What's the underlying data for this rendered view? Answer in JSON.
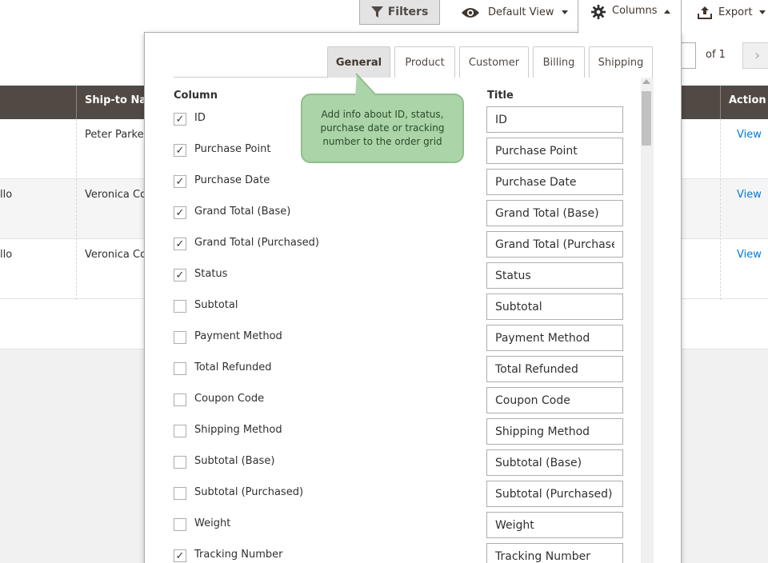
{
  "toolbar": {
    "filters_label": "Filters",
    "view_label": "Default View",
    "columns_label": "Columns",
    "export_label": "Export"
  },
  "pager": {
    "of_text": "of 1"
  },
  "grid": {
    "headers": {
      "ship_to": "Ship-to Nam",
      "action": "Action"
    },
    "rows": [
      {
        "left": "",
        "ship_to": "Peter Parker",
        "action": "View"
      },
      {
        "left": "llo",
        "ship_to": "Veronica Cos",
        "action": "View"
      },
      {
        "left": "llo",
        "ship_to": "Veronica Cos",
        "action": "View"
      }
    ]
  },
  "columns_panel": {
    "tabs": [
      {
        "label": "General",
        "active": true
      },
      {
        "label": "Product",
        "active": false
      },
      {
        "label": "Customer",
        "active": false
      },
      {
        "label": "Billing",
        "active": false
      },
      {
        "label": "Shipping",
        "active": false
      }
    ],
    "column_header": "Column",
    "title_header": "Title",
    "items": [
      {
        "label": "ID",
        "checked": true,
        "title": "ID"
      },
      {
        "label": "Purchase Point",
        "checked": true,
        "title": "Purchase Point"
      },
      {
        "label": "Purchase Date",
        "checked": true,
        "title": "Purchase Date"
      },
      {
        "label": "Grand Total (Base)",
        "checked": true,
        "title": "Grand Total (Base)"
      },
      {
        "label": "Grand Total (Purchased)",
        "checked": true,
        "title": "Grand Total (Purchased)"
      },
      {
        "label": "Status",
        "checked": true,
        "title": "Status"
      },
      {
        "label": "Subtotal",
        "checked": false,
        "title": "Subtotal"
      },
      {
        "label": "Payment Method",
        "checked": false,
        "title": "Payment Method"
      },
      {
        "label": "Total Refunded",
        "checked": false,
        "title": "Total Refunded"
      },
      {
        "label": "Coupon Code",
        "checked": false,
        "title": "Coupon Code"
      },
      {
        "label": "Shipping Method",
        "checked": false,
        "title": "Shipping Method"
      },
      {
        "label": "Subtotal (Base)",
        "checked": false,
        "title": "Subtotal (Base)"
      },
      {
        "label": "Subtotal (Purchased)",
        "checked": false,
        "title": "Subtotal (Purchased)"
      },
      {
        "label": "Weight",
        "checked": false,
        "title": "Weight"
      },
      {
        "label": "Tracking Number",
        "checked": true,
        "title": "Tracking Number"
      }
    ]
  },
  "tooltip": {
    "text": "Add info about ID, status, purchase date or tracking number to the order grid"
  },
  "colors": {
    "grid_header": "#514943",
    "link": "#007bdb",
    "tooltip_bg": "#abd4a9",
    "tab_active": "#e3e3e3"
  },
  "icons": [
    "filter-icon",
    "eye-icon",
    "gear-icon",
    "export-icon",
    "chevron-right-icon",
    "checkmark-icon"
  ]
}
